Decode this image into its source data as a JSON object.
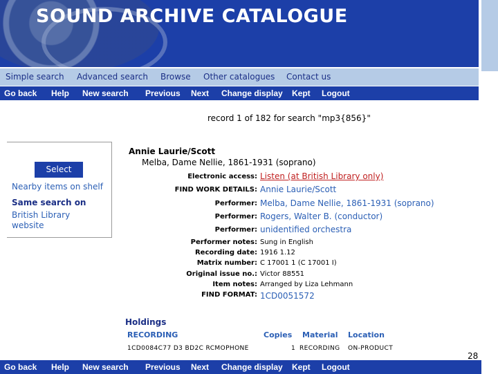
{
  "banner": {
    "title": "SOUND ARCHIVE CATALOGUE"
  },
  "menu": [
    "Simple search",
    "Advanced search",
    "Browse",
    "Other catalogues",
    "Contact us"
  ],
  "toolbar": [
    "Go back",
    "Help",
    "New search",
    "Previous",
    "Next",
    "Change display",
    "Kept",
    "Logout"
  ],
  "record_status": "record 1 of 182 for search \"mp3{856}\"",
  "sidebar": {
    "select_label": "Select",
    "nearby_label": "Nearby items on shelf",
    "same_search_label": "Same search on",
    "bl_website_label": "British Library website"
  },
  "record": {
    "title": "Annie Laurie/Scott",
    "subtitle": "Melba, Dame Nellie, 1861-1931 (soprano)",
    "fields": [
      {
        "label": "Electronic access:",
        "value": "Listen (at British Library only)"
      },
      {
        "label": "FIND WORK DETAILS:",
        "value": "Annie Laurie/Scott"
      },
      {
        "label": "Performer:",
        "value": "Melba, Dame Nellie, 1861-1931 (soprano)"
      },
      {
        "label": "Performer:",
        "value": "Rogers, Walter B. (conductor)"
      },
      {
        "label": "Performer:",
        "value": "unidentified orchestra"
      },
      {
        "label": "Performer notes:",
        "value": "Sung in English"
      },
      {
        "label": "Recording date:",
        "value": "1916 1.12"
      },
      {
        "label": "Matrix number:",
        "value": "C 17001 1 (C 17001 I)"
      },
      {
        "label": "Original issue no.:",
        "value": "Victor 88551"
      },
      {
        "label": "Item notes:",
        "value": "Arranged by Liza Lehmann"
      },
      {
        "label": "FIND FORMAT:",
        "value": "1CD0051572"
      }
    ]
  },
  "holdings": {
    "title": "Holdings",
    "headers": [
      "RECORDING",
      "Copies",
      "Material",
      "Location"
    ],
    "row": [
      "1CD0084C77 D3 BD2C RCMOPHONE",
      "1",
      "RECORDING",
      "ON-PRODUCT"
    ]
  },
  "page_number": "28",
  "colors": {
    "banner_blue": "#1c3fa8",
    "menu_light_blue": "#b5cbe6",
    "link_blue": "#2b5fb5",
    "access_red": "#c02020"
  }
}
